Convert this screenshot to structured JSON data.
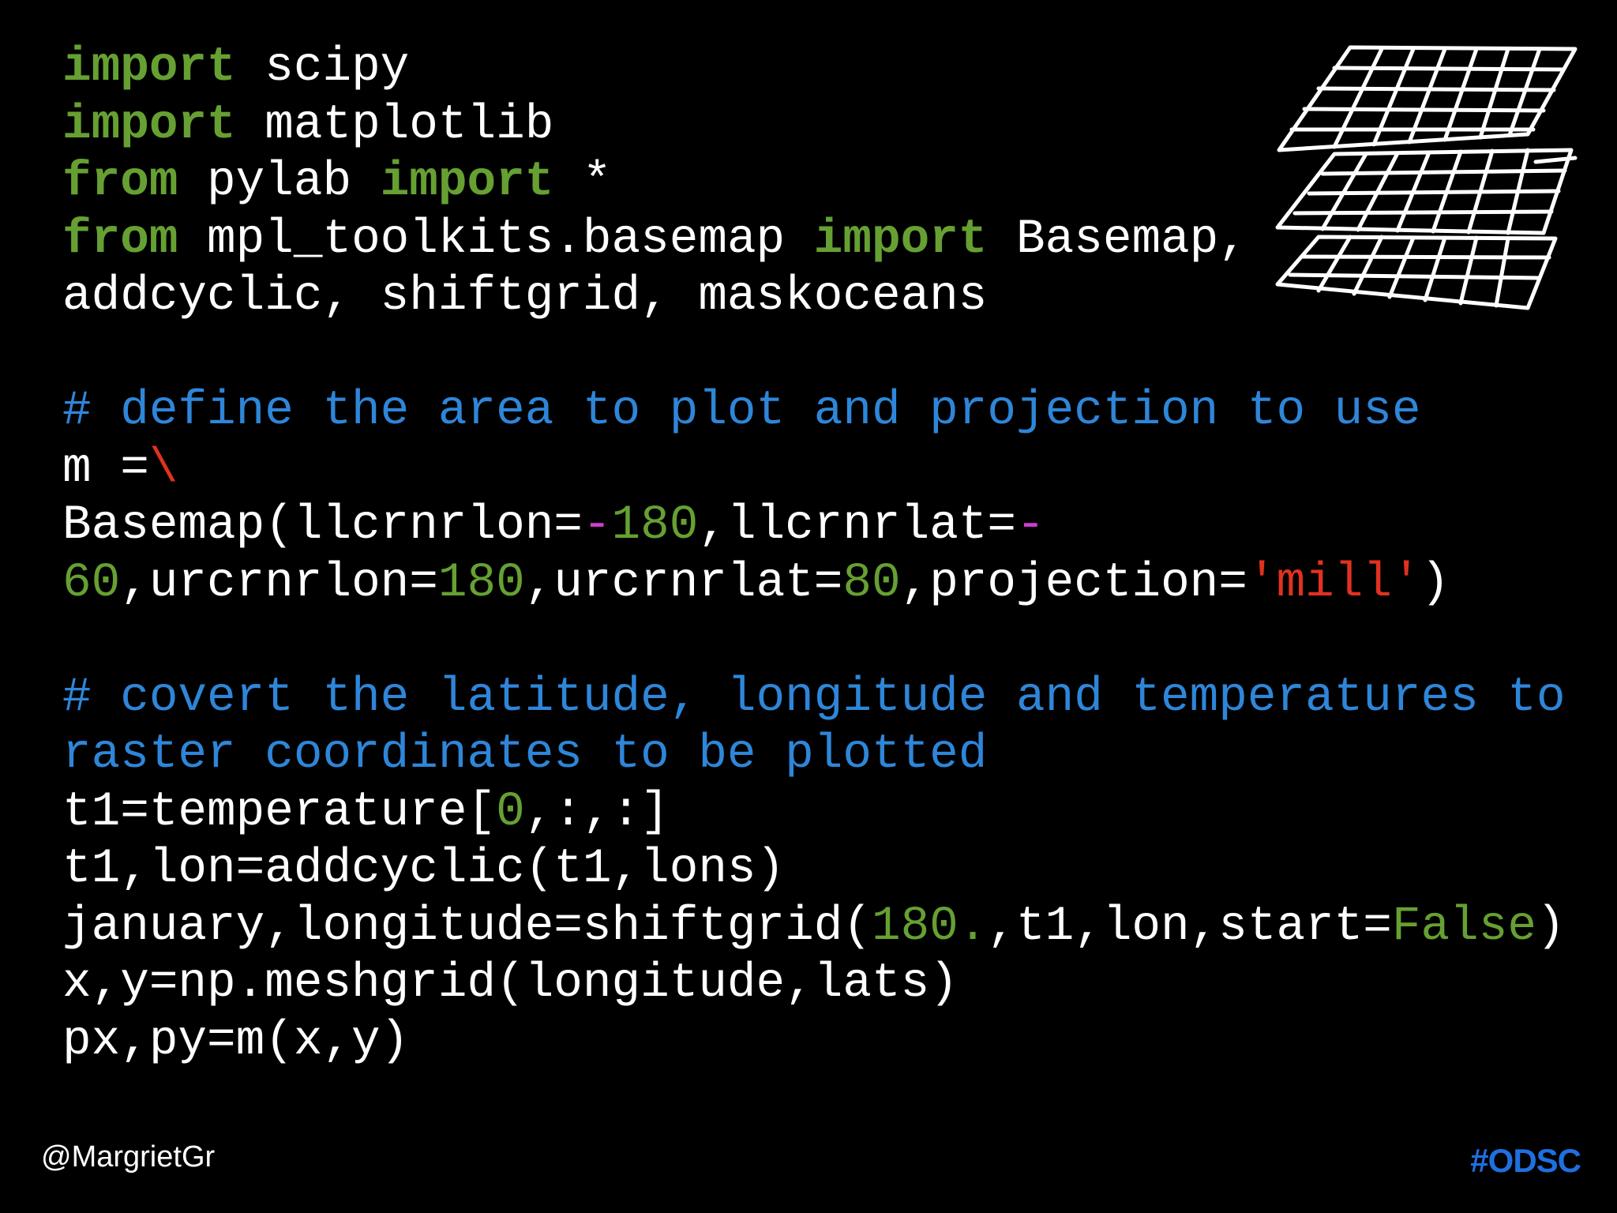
{
  "code": {
    "line1": {
      "kw": "import",
      "rest": " scipy"
    },
    "line2": {
      "kw": "import",
      "rest": " matplotlib"
    },
    "line3": {
      "kw1": "from",
      "mid": " pylab ",
      "kw2": "import",
      "rest": " *"
    },
    "line4": {
      "kw1": "from",
      "mid": " mpl_toolkits.basemap ",
      "kw2": "import",
      "rest": " Basemap,"
    },
    "line5": {
      "text": "addcyclic, shiftgrid, maskoceans"
    },
    "line7": {
      "comment": "# define the area to plot and projection to use"
    },
    "line8": {
      "text": "m =",
      "esc": "\\"
    },
    "line9": {
      "a": "Basemap(llcrnrlon=",
      "op1": "-",
      "n1": "180",
      "b": ",llcrnrlat=",
      "op2": "-"
    },
    "line10": {
      "n1": "60",
      "a": ",urcrnrlon=",
      "n2": "180",
      "b": ",urcrnrlat=",
      "n3": "80",
      "c": ",projection=",
      "s": "'mill'",
      "d": ")"
    },
    "line12": {
      "comment": "# covert the latitude, longitude and temperatures to"
    },
    "line13": {
      "comment": "raster coordinates to be plotted"
    },
    "line14": {
      "a": "t1=temperature[",
      "n": "0",
      "b": ",:,:]"
    },
    "line15": {
      "text": "t1,lon=addcyclic(t1,lons)"
    },
    "line16": {
      "a": "january,longitude=shiftgrid(",
      "n": "180.",
      "b": ",t1,lon,start=",
      "k": "False",
      "c": ")"
    },
    "line17": {
      "text": "x,y=np.meshgrid(longitude,lats)"
    },
    "line18": {
      "text": "px,py=m(x,y)"
    }
  },
  "footer": {
    "handle": "@MargrietGr",
    "brand": "#ODSC"
  },
  "colors": {
    "background": "#000000",
    "keyword": "#66a032",
    "comment": "#2e86d9",
    "string": "#e0321f",
    "operator": "#d03cd0",
    "brand": "#1f6fe0"
  },
  "icons": [
    "stacked-grid-layers-icon",
    "odsc-logo"
  ]
}
